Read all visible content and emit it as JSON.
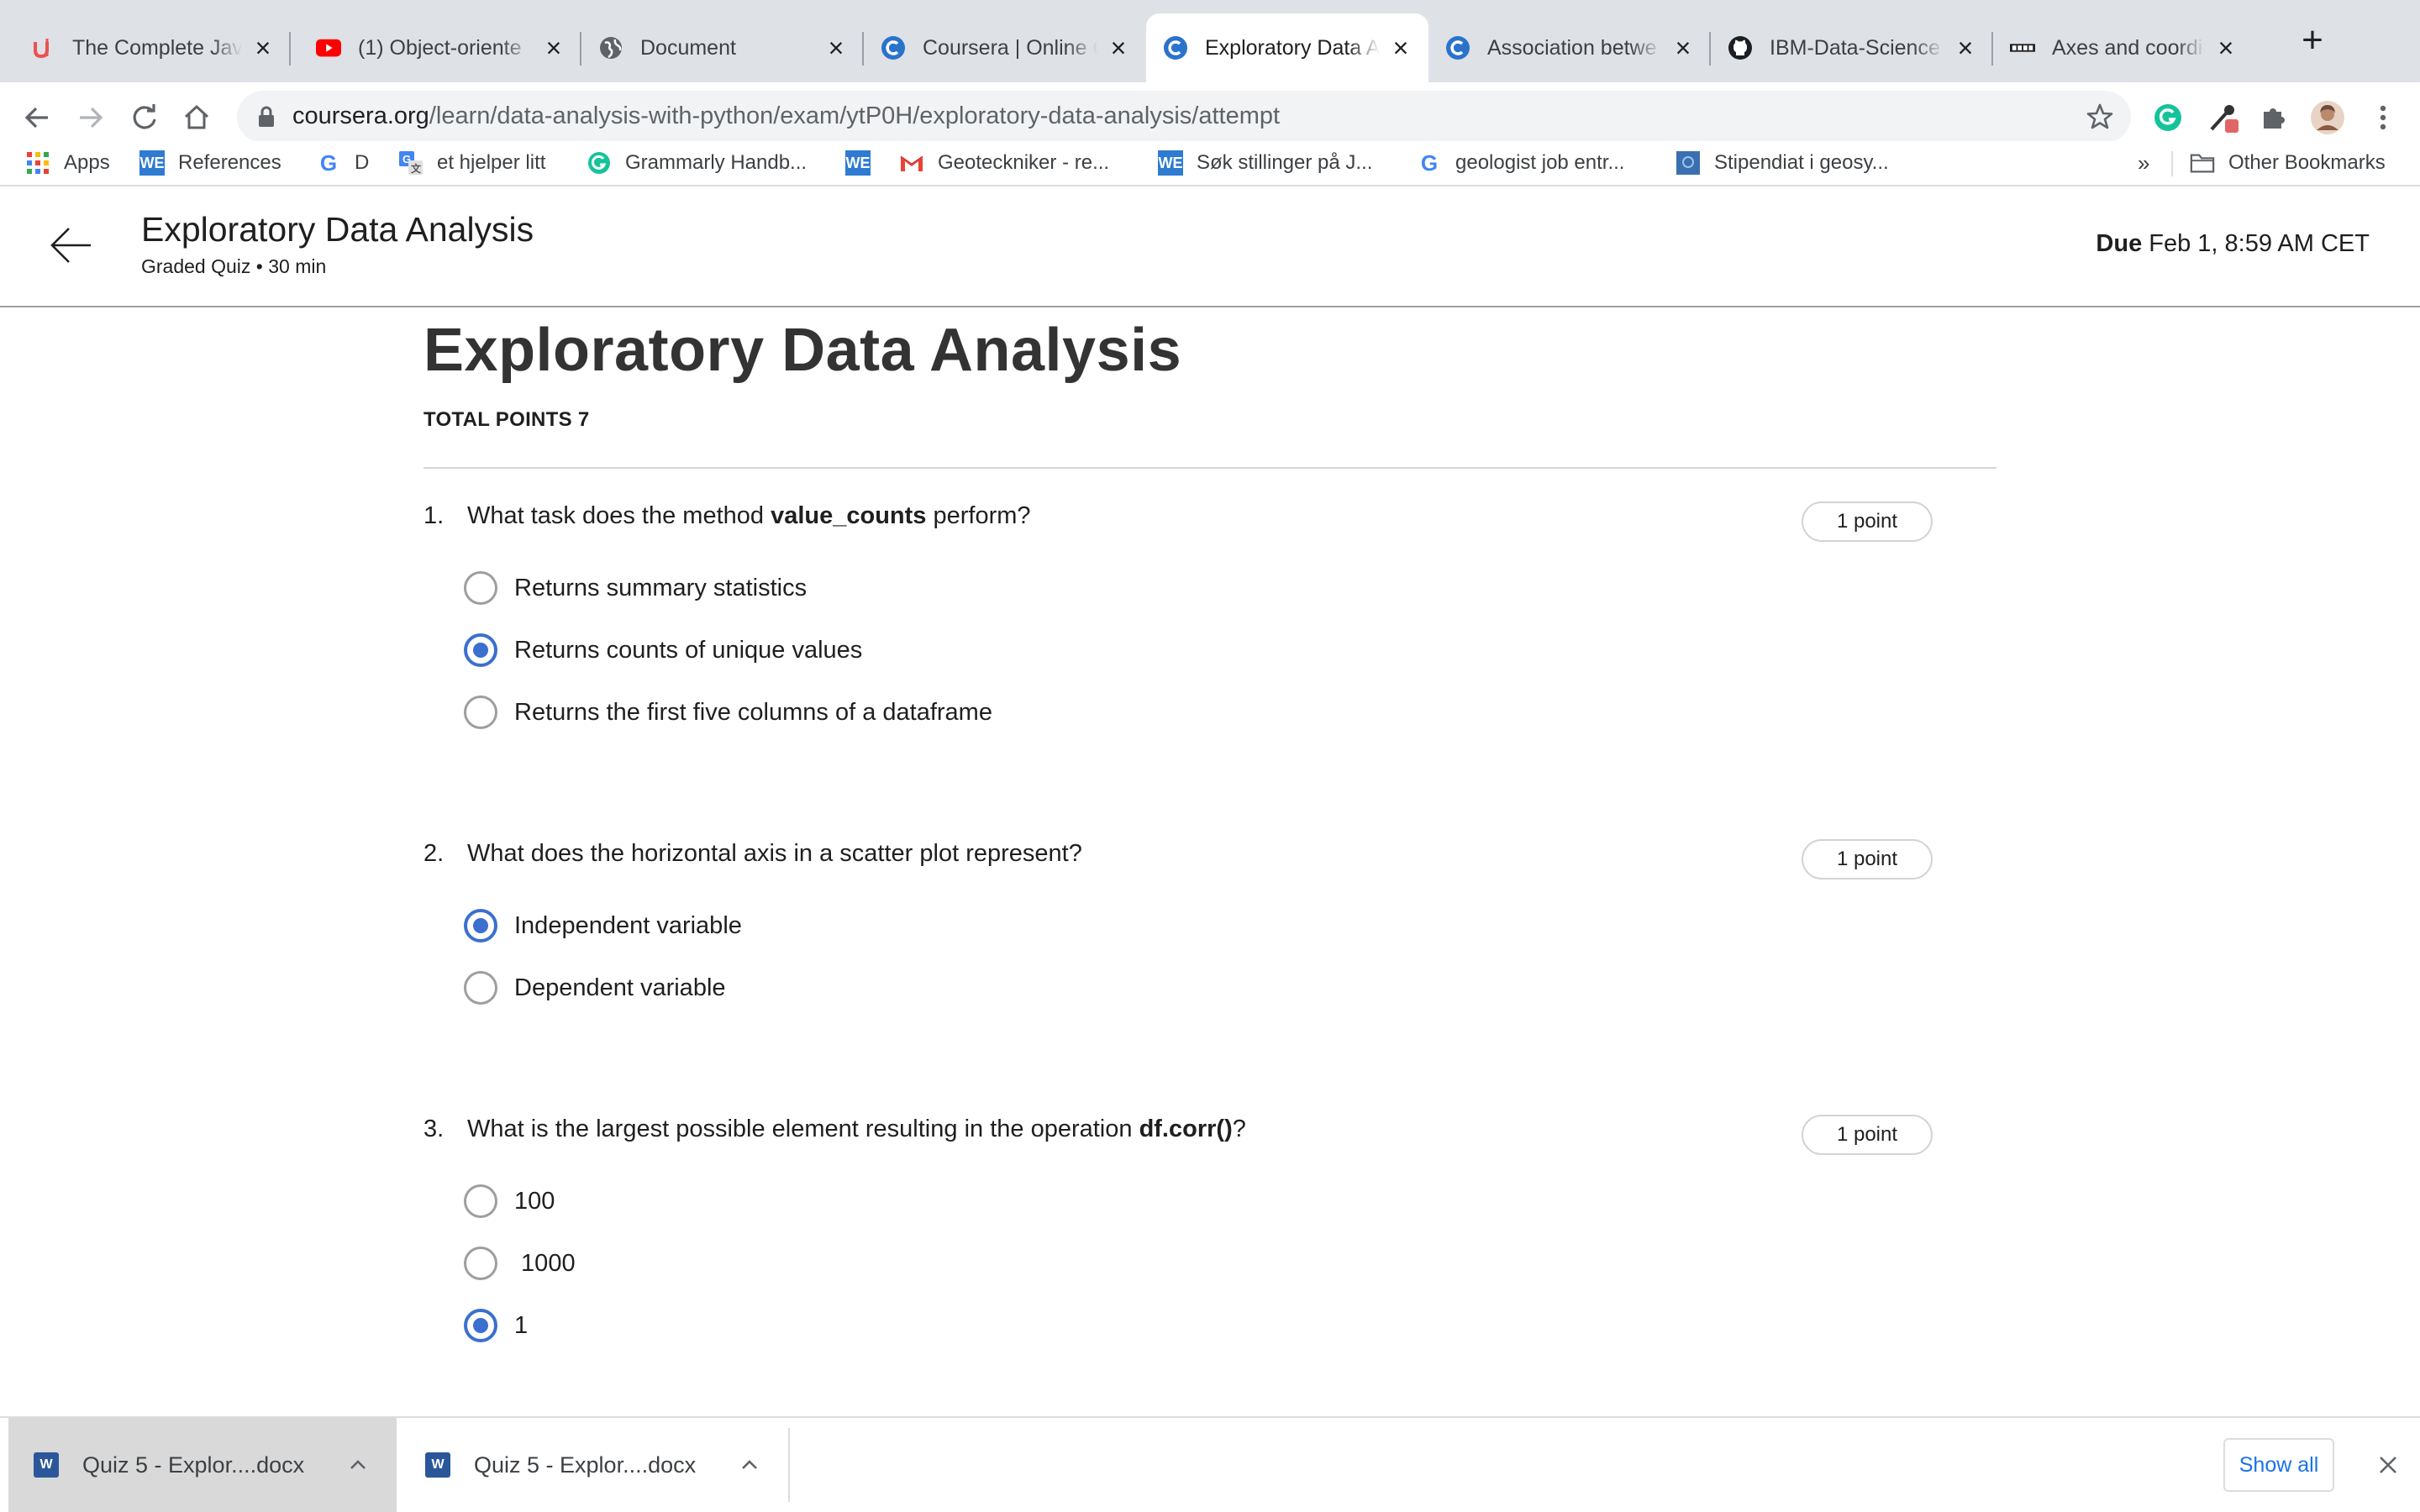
{
  "browser": {
    "tabs": [
      {
        "title": "The Complete Jav",
        "icon": "udemy-icon",
        "active": false
      },
      {
        "title": "(1) Object-oriente",
        "icon": "youtube-icon",
        "active": false
      },
      {
        "title": "Document",
        "icon": "globe-icon",
        "active": false
      },
      {
        "title": "Coursera | Online C",
        "icon": "coursera-icon",
        "active": false
      },
      {
        "title": "Exploratory Data A",
        "icon": "coursera-icon",
        "active": true
      },
      {
        "title": "Association betwe",
        "icon": "coursera-icon",
        "active": false
      },
      {
        "title": "IBM-Data-Science",
        "icon": "github-icon",
        "active": false
      },
      {
        "title": "Axes and coordina",
        "icon": "bbox-icon",
        "active": false
      }
    ],
    "url_host": "coursera.org",
    "url_path": "/learn/data-analysis-with-python/exam/ytP0H/exploratory-data-analysis/attempt",
    "bookmarks": [
      {
        "label": "Apps",
        "icon": "apps-grid-icon"
      },
      {
        "label": "References",
        "icon": "we-icon"
      },
      {
        "label": "D",
        "icon": "google-icon"
      },
      {
        "label": "et hjelper litt",
        "icon": "translate-icon"
      },
      {
        "label": "Grammarly Handb...",
        "icon": "grammarly-icon"
      },
      {
        "label": "",
        "icon": "we-icon"
      },
      {
        "label": "Geoteckniker - re...",
        "icon": "gmail-icon"
      },
      {
        "label": "Søk stillinger på J...",
        "icon": "we-icon"
      },
      {
        "label": "geologist job entr...",
        "icon": "google-icon"
      },
      {
        "label": "Stipendiat i geosy...",
        "icon": "bookmark-page-icon"
      }
    ],
    "bookmarks_overflow": "»",
    "other_bookmarks": "Other Bookmarks"
  },
  "header": {
    "title": "Exploratory Data Analysis",
    "subtitle": "Graded Quiz • 30 min",
    "due_label": "Due",
    "due_value": "Feb 1, 8:59 AM CET"
  },
  "quiz": {
    "title": "Exploratory Data Analysis",
    "total_points": "TOTAL POINTS 7",
    "questions": [
      {
        "number": "1.",
        "text_before": "What task does the method ",
        "text_bold": "value_counts",
        "text_after": " perform?",
        "points": "1 point",
        "options": [
          {
            "label": "Returns summary statistics",
            "selected": false
          },
          {
            "label": "Returns counts of unique values",
            "selected": true
          },
          {
            "label": "Returns the first five columns of a dataframe",
            "selected": false
          }
        ]
      },
      {
        "number": "2.",
        "text_before": "What does the horizontal axis in a scatter plot represent?",
        "text_bold": "",
        "text_after": "",
        "points": "1 point",
        "options": [
          {
            "label": "Independent variable",
            "selected": true
          },
          {
            "label": "Dependent variable",
            "selected": false
          }
        ]
      },
      {
        "number": "3.",
        "text_before": "What is the largest possible element resulting in the operation ",
        "text_bold": "df.corr()",
        "text_after": "?",
        "points": "1 point",
        "options": [
          {
            "label": "100",
            "selected": false
          },
          {
            "label": " 1000",
            "selected": false
          },
          {
            "label": "1",
            "selected": true
          }
        ]
      }
    ]
  },
  "downloads": {
    "items": [
      {
        "name": "Quiz 5 - Explor....docx"
      },
      {
        "name": "Quiz 5 - Explor....docx"
      }
    ],
    "show_all": "Show all"
  },
  "colors": {
    "accent": "#3b6fd0",
    "link": "#1a73e8",
    "tabstrip": "#dee1e6"
  }
}
